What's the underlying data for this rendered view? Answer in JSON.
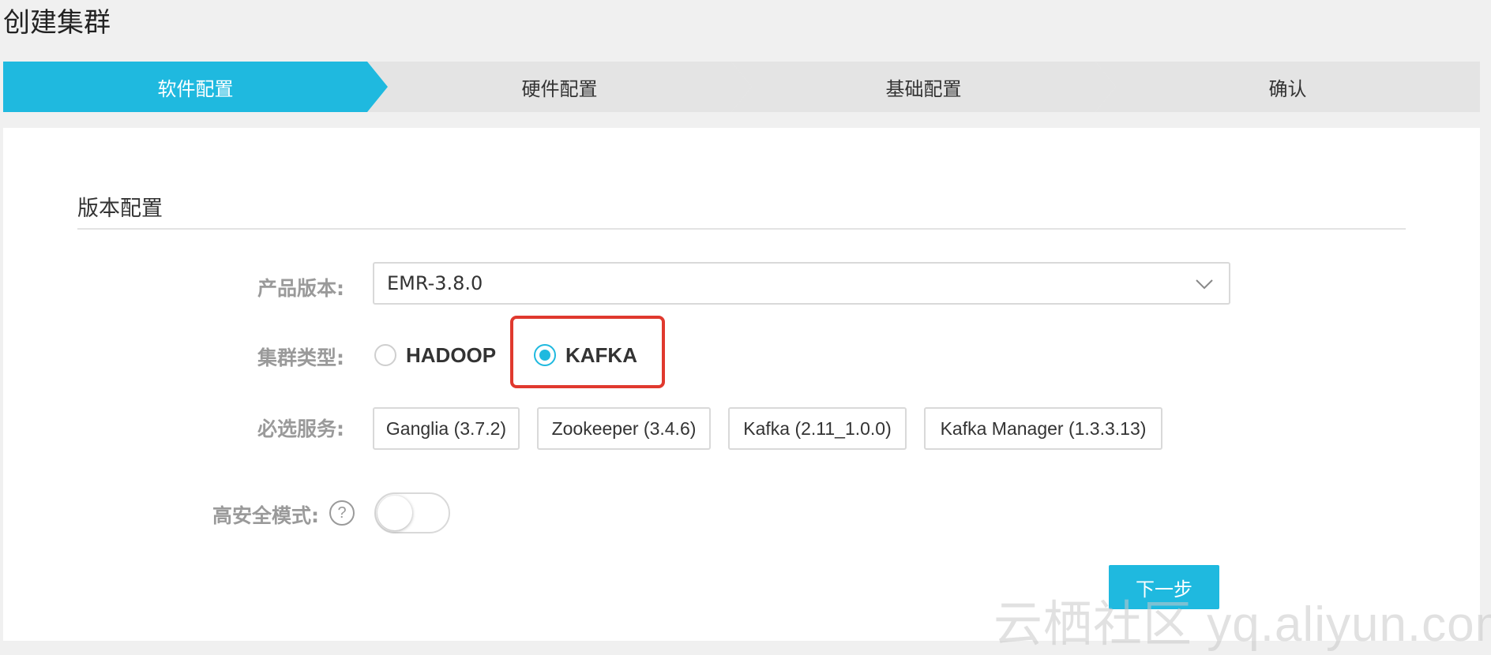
{
  "page_title": "创建集群",
  "steps": [
    {
      "label": "软件配置",
      "active": true
    },
    {
      "label": "硬件配置",
      "active": false
    },
    {
      "label": "基础配置",
      "active": false
    },
    {
      "label": "确认",
      "active": false
    }
  ],
  "section": {
    "title": "版本配置"
  },
  "form": {
    "product_version": {
      "label": "产品版本:",
      "value": "EMR-3.8.0"
    },
    "cluster_type": {
      "label": "集群类型:",
      "options": [
        "HADOOP",
        "KAFKA"
      ],
      "selected": "KAFKA"
    },
    "required_services": {
      "label": "必选服务:",
      "items": [
        "Ganglia (3.7.2)",
        "Zookeeper (3.4.6)",
        "Kafka (2.11_1.0.0)",
        "Kafka Manager (1.3.3.13)"
      ]
    },
    "high_security": {
      "label": "高安全模式:",
      "help_icon": "question-circle-icon",
      "help_glyph": "?",
      "enabled": false
    }
  },
  "actions": {
    "next_label": "下一步"
  },
  "watermark": "云栖社区 yq.aliyun.com",
  "colors": {
    "accent": "#1fb9df",
    "highlight": "#e0392e",
    "step_inactive": "#e4e4e4"
  }
}
